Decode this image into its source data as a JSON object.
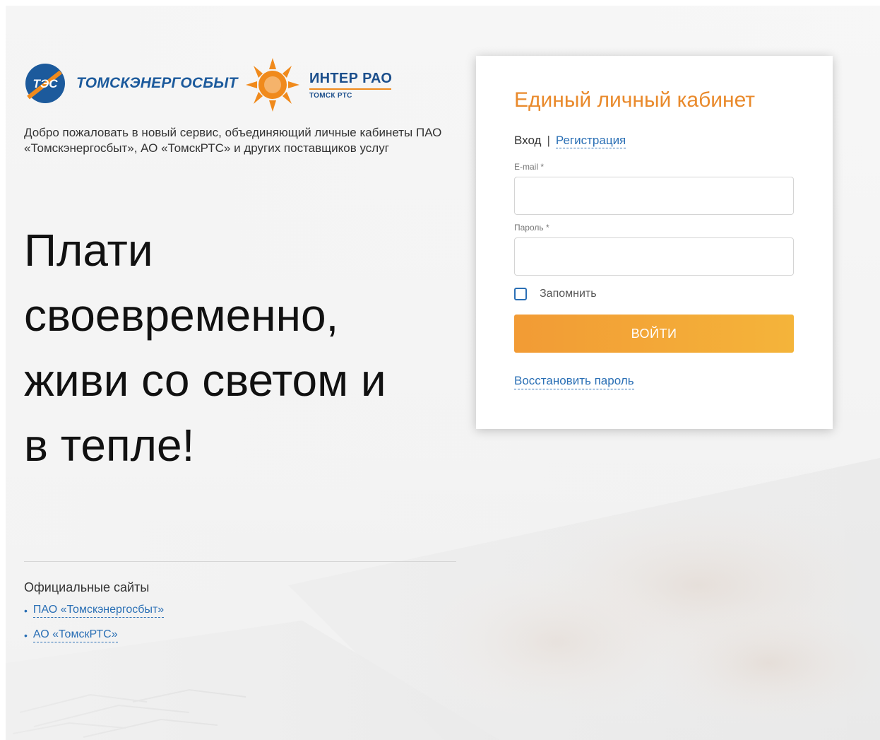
{
  "brand": {
    "tes_badge": "ТЭС",
    "tes_name": "ТОМСКЭНЕРГОСБЫТ",
    "inter_name": "ИНТЕР РАО",
    "inter_sub": "ТОМСК РТС"
  },
  "welcome_text": "Добро пожаловать в новый сервис, объединяющий личные кабинеты ПАО «Томскэнергосбыт», АО «ТомскРТС» и других поставщиков услуг",
  "slogan": {
    "line1": "Плати",
    "line2": "своевременно,",
    "line3": "живи со светом и",
    "line4": "в тепле!"
  },
  "official_sites": {
    "title": "Официальные сайты",
    "links": [
      {
        "bullet": "•",
        "label": "ПАО «Томскэнергосбыт»"
      },
      {
        "bullet": "•",
        "label": "АО «ТомскРТС»"
      }
    ]
  },
  "login_card": {
    "title": "Единый личный кабинет",
    "tab_login": "Вход",
    "tab_sep": "|",
    "tab_register": "Регистрация",
    "email_label": "E-mail *",
    "email_value": "",
    "password_label": "Пароль *",
    "password_value": "",
    "remember_label": "Запомнить",
    "remember_checked": false,
    "submit_label": "ВОЙТИ",
    "restore_label": "Восстановить пароль"
  },
  "colors": {
    "accent_orange": "#e98a2c",
    "button_gradient_start": "#f29b35",
    "button_gradient_end": "#f4b43a",
    "link_blue": "#2a6fb5",
    "brand_blue": "#1c5a9c"
  },
  "icons": {
    "tes_logo": "tes-logo-icon",
    "sun_logo": "inter-rao-sun-icon",
    "checkbox": "checkbox-icon"
  }
}
